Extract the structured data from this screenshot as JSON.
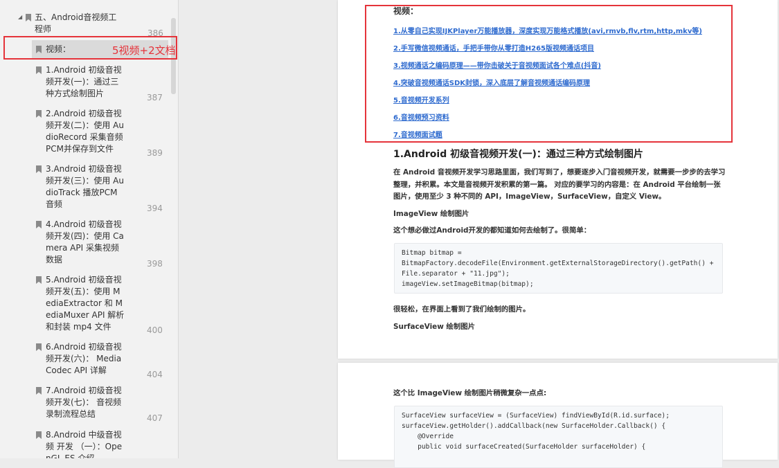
{
  "sidebar": {
    "parent": {
      "label1": "五、Android音视频工",
      "label2": "程师",
      "page": "386"
    },
    "selected": {
      "label": "视频："
    },
    "items": [
      {
        "lines": [
          "1.Android 初级音视",
          "频开发(一)：通过三",
          "种方式绘制图片"
        ],
        "page": "387"
      },
      {
        "lines": [
          "2.Android 初级音视",
          "频开发(二)：使用 Au",
          "dioRecord 采集音频",
          "PCM并保存到文件"
        ],
        "page": "389"
      },
      {
        "lines": [
          "3.Android 初级音视",
          "频开发(三)：使用 Au",
          "dioTrack 播放PCM",
          "音频"
        ],
        "page": "394"
      },
      {
        "lines": [
          "4.Android 初级音视",
          "频开发(四)：使用 Ca",
          "mera API 采集视频",
          "数据"
        ],
        "page": "398"
      },
      {
        "lines": [
          "5.Android 初级音视",
          "频开发(五)：使用 M",
          "ediaExtractor 和 M",
          "ediaMuxer API 解析",
          "和封装 mp4 文件"
        ],
        "page": "400"
      },
      {
        "lines": [
          "6.Android 初级音视",
          "频开发(六)： Media",
          "Codec API 详解"
        ],
        "page": "404"
      },
      {
        "lines": [
          "7.Android 初级音视",
          "频开发(七)： 音视频",
          "录制流程总结"
        ],
        "page": "407"
      },
      {
        "lines": [
          "8.Android 中级音视",
          "频 开发 （一）：Ope",
          "nGL ES 介绍"
        ],
        "page": ""
      }
    ]
  },
  "annotation": {
    "text": "5视频+2文档",
    "color": "#e5333a"
  },
  "doc": {
    "page1": {
      "video_heading": "视频：",
      "links": [
        "1.从零自己实现IJKPlayer万能播放器，深度实现万能格式播放(avi,rmvb,flv,rtm,http,mkv等)",
        "2.手写微信视频通话，手把手带你从零打造H265版视频通话项目",
        "3.视频通话之编码原理——带你击破关于音视频面试各个难点(抖音)",
        "4.突破音视频通话SDK封锁，深入底层了解音视频通话编码原理",
        "5.音视频开发系列",
        "6.音视频预习资料",
        "7.音视频面试题"
      ],
      "article_title": "1.Android 初级音视频开发(一)：通过三种方式绘制图片",
      "intro_lines": [
        "在 Android 音视频开发学习思路里面，我们写到了，想要逐步入门音视频开发，就需要一步步的去学习",
        "整理，并积累。本文是音视频开发积累的第一篇。 对应的要学习的内容是：在 Android 平台绘制一张",
        "图片，使用至少 3 种不同的 API，ImageView，SurfaceView，自定义 View。"
      ],
      "imageview_heading": "ImageView 绘制图片",
      "imageview_desc": "这个想必做过Android开发的都知道如何去绘制了。很简单：",
      "code1": [
        "Bitmap bitmap =",
        "BitmapFactory.decodeFile(Environment.getExternalStorageDirectory().getPath() +",
        "File.separator + \"11.jpg\");",
        "imageView.setImageBitmap(bitmap);"
      ],
      "after_code": "很轻松，在界面上看到了我们绘制的图片。",
      "surfaceview_heading": "SurfaceView 绘制图片"
    },
    "page2": {
      "desc": "这个比 ImageView 绘制图片稍微复杂一点点:",
      "code2": [
        "SurfaceView surfaceView = (SurfaceView) findViewById(R.id.surface);",
        "surfaceView.getHolder().addCallback(new SurfaceHolder.Callback() {",
        "    @Override",
        "    public void surfaceCreated(SurfaceHolder surfaceHolder) {"
      ]
    }
  }
}
